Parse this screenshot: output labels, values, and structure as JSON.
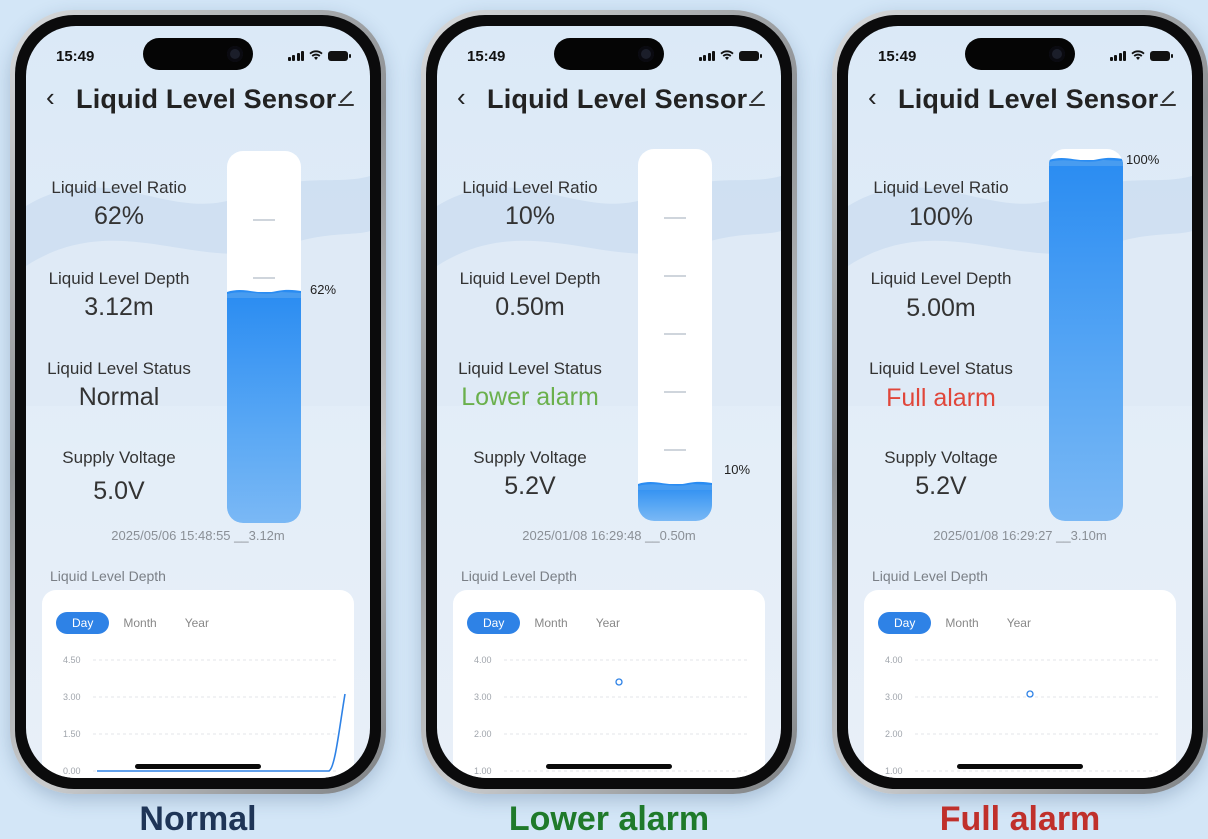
{
  "phones": [
    {
      "status_time": "15:49",
      "title": "Liquid Level Sensor",
      "ratio_label": "Liquid Level Ratio",
      "ratio_value": "62%",
      "depth_label": "Liquid Level Depth",
      "depth_value": "3.12m",
      "status_label": "Liquid Level Status",
      "status_value": "Normal",
      "voltage_label": "Supply Voltage",
      "voltage_value": "5.0V",
      "tank_label": "62%",
      "tank_fill_fraction": 0.62,
      "timestamp": "2025/05/06 15:48:55 __3.12m",
      "section_title": "Liquid Level Depth",
      "tabs": [
        "Day",
        "Month",
        "Year"
      ],
      "y_ticks": [
        "4.50",
        "3.00",
        "1.50",
        "0.00"
      ],
      "caption": "Normal",
      "caption_color": "#1f3557"
    },
    {
      "status_time": "15:49",
      "title": "Liquid Level Sensor",
      "ratio_label": "Liquid Level Ratio",
      "ratio_value": "10%",
      "depth_label": "Liquid Level Depth",
      "depth_value": "0.50m",
      "status_label": "Liquid Level Status",
      "status_value": "Lower alarm",
      "voltage_label": "Supply Voltage",
      "voltage_value": "5.2V",
      "tank_label": "10%",
      "tank_fill_fraction": 0.1,
      "timestamp": "2025/01/08 16:29:48 __0.50m",
      "section_title": "Liquid Level Depth",
      "tabs": [
        "Day",
        "Month",
        "Year"
      ],
      "y_ticks": [
        "4.00",
        "3.00",
        "2.00",
        "1.00"
      ],
      "caption": "Lower alarm",
      "caption_color": "#1f7a2a"
    },
    {
      "status_time": "15:49",
      "title": "Liquid Level Sensor",
      "ratio_label": "Liquid Level Ratio",
      "ratio_value": "100%",
      "depth_label": "Liquid Level Depth",
      "depth_value": "5.00m",
      "status_label": "Liquid Level Status",
      "status_value": "Full alarm",
      "voltage_label": "Supply Voltage",
      "voltage_value": "5.2V",
      "tank_label": "100%",
      "tank_fill_fraction": 1.0,
      "timestamp": "2025/01/08 16:29:27 __3.10m",
      "section_title": "Liquid Level Depth",
      "tabs": [
        "Day",
        "Month",
        "Year"
      ],
      "y_ticks": [
        "4.00",
        "3.00",
        "2.00",
        "1.00"
      ],
      "caption": "Full alarm",
      "caption_color": "#c0302b"
    }
  ],
  "colors": {
    "status_normal": "#333333",
    "status_lower": "#6ab04c",
    "status_full": "#e0463a",
    "accent": "#2e82e6"
  }
}
